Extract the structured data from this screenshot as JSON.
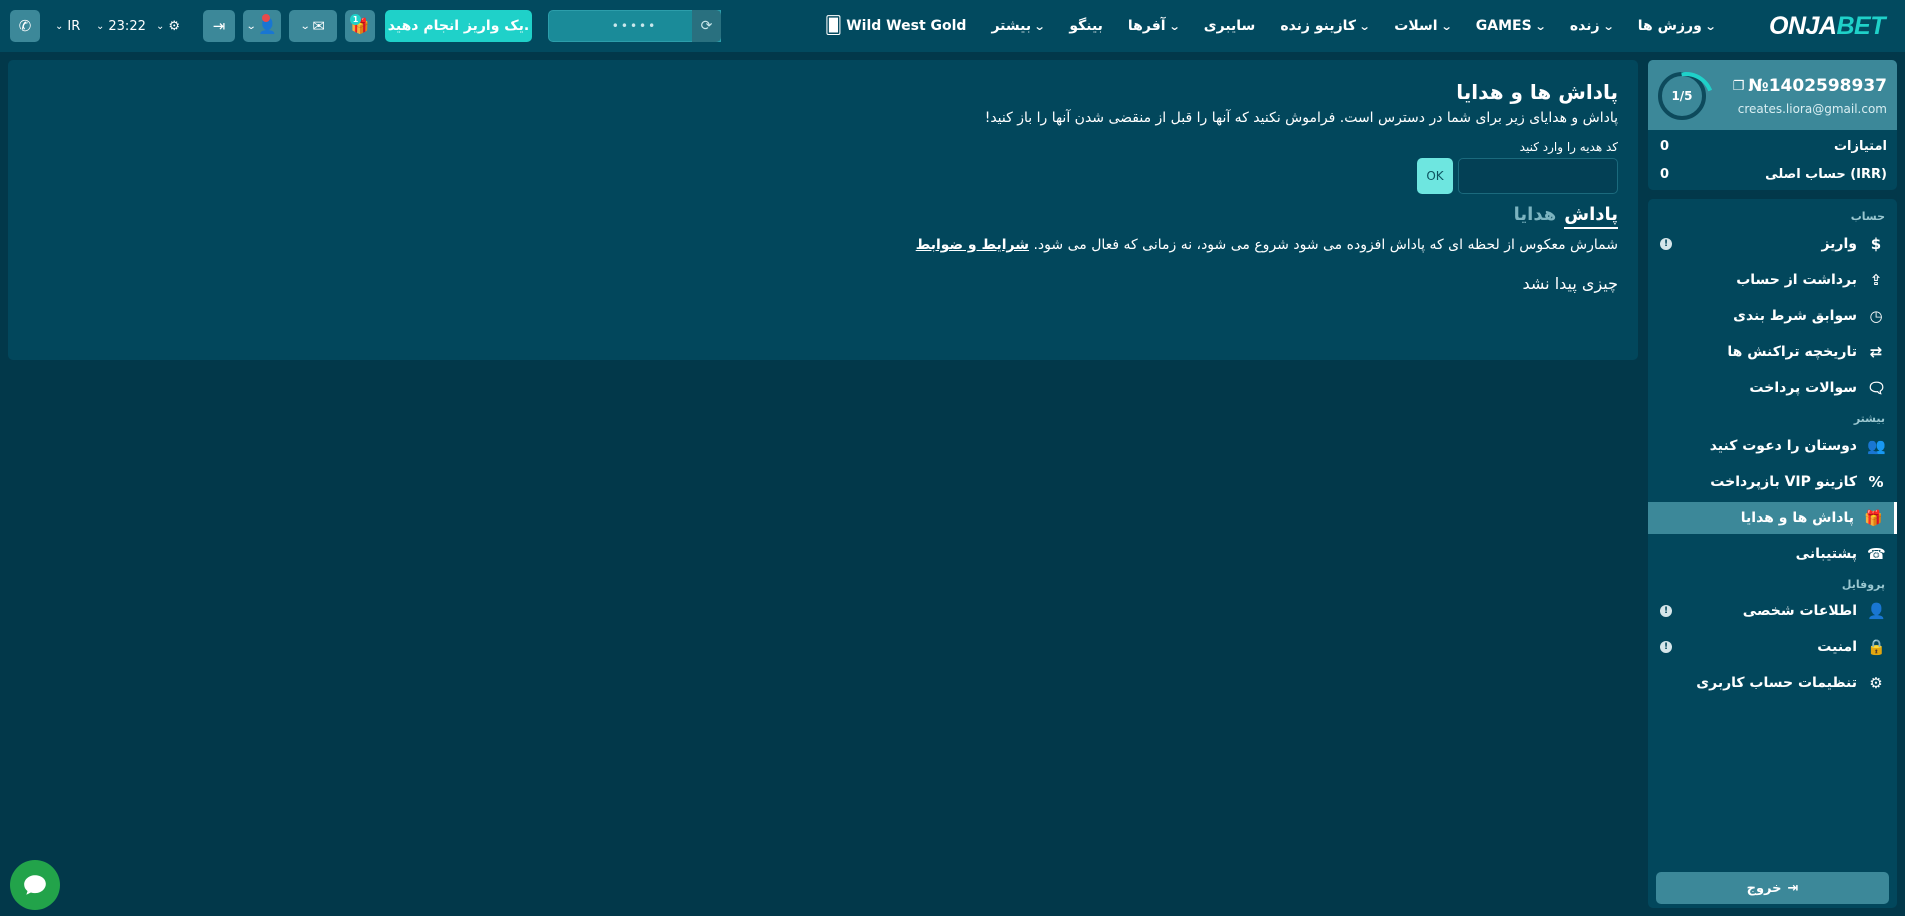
{
  "header": {
    "logo_main": "ONJA",
    "logo_accent": "BET",
    "nav": [
      {
        "label": "ورزش ها",
        "chevron": true
      },
      {
        "label": "زنده",
        "chevron": true
      },
      {
        "label": "GAMES",
        "chevron": true
      },
      {
        "label": "اسلات",
        "chevron": true
      },
      {
        "label": "کازینو زنده",
        "chevron": true
      },
      {
        "label": "سایبری",
        "chevron": false
      },
      {
        "label": "آفرها",
        "chevron": true
      },
      {
        "label": "بینگو",
        "chevron": false
      },
      {
        "label": "بیشتر",
        "chevron": true
      },
      {
        "label": "Wild West Gold",
        "chevron": false
      }
    ],
    "search_mask": "•••••",
    "deposit_label": "یک واریز انجام دهید.",
    "gift_count": "1",
    "time": "23:22",
    "region": "IR"
  },
  "main": {
    "title": "پاداش ها و هدایا",
    "subtitle": "پاداش و هدایای زیر برای شما در دسترس است. فراموش نکنید که آنها را قبل از منقضی شدن آنها را باز کنید!",
    "code_label": "کد هدیه را وارد کنید",
    "code_value": "",
    "ok_label": "OK",
    "tabs": [
      {
        "label": "پاداش",
        "active": true
      },
      {
        "label": "هدایا",
        "active": false
      }
    ],
    "countdown_text": "شمارش معکوس از لحظه ای که پاداش افزوده می شود شروع می شود، نه زمانی که فعال می شود.",
    "terms_label": "شرایط و ضوابط",
    "empty_text": "چیزی پیدا نشد"
  },
  "account": {
    "level": "1/5",
    "id": "№1402598937",
    "email": "creates.liora@gmail.com",
    "points_label": "امتیازات",
    "points_value": "0",
    "balance_label": "حساب اصلی (IRR)",
    "balance_value": "0"
  },
  "menu": {
    "section_account": "حساب",
    "section_more": "بیشتر",
    "section_profile": "پروفایل",
    "items": [
      {
        "label": "واریز",
        "icon": "dollar-icon"
      },
      {
        "label": "برداشت از حساب",
        "icon": "upload-icon"
      },
      {
        "label": "سوابق شرط بندی",
        "icon": "clock-icon"
      },
      {
        "label": "تاریخچه تراکنش ها",
        "icon": "transfer-icon"
      },
      {
        "label": "سوالات پرداخت",
        "icon": "money-chat-icon"
      },
      {
        "label": "دوستان را دعوت کنید",
        "icon": "users-icon"
      },
      {
        "label": "بازپرداخت VIP کازینو",
        "icon": "percent-icon"
      },
      {
        "label": "پاداش ها و هدایا",
        "icon": "gift-icon"
      },
      {
        "label": "پشتیبانی",
        "icon": "support-icon"
      },
      {
        "label": "اطلاعات شخصی",
        "icon": "user-icon"
      },
      {
        "label": "امنیت",
        "icon": "lock-icon"
      },
      {
        "label": "تنظیمات حساب کاربری",
        "icon": "gear-icon"
      }
    ],
    "logout_label": "خروج"
  },
  "colors": {
    "background": "#02384a",
    "header": "#024a5f",
    "panel": "#02475c",
    "accent": "#1fd1c9",
    "button": "#3c8899",
    "chat": "#22a34a"
  }
}
